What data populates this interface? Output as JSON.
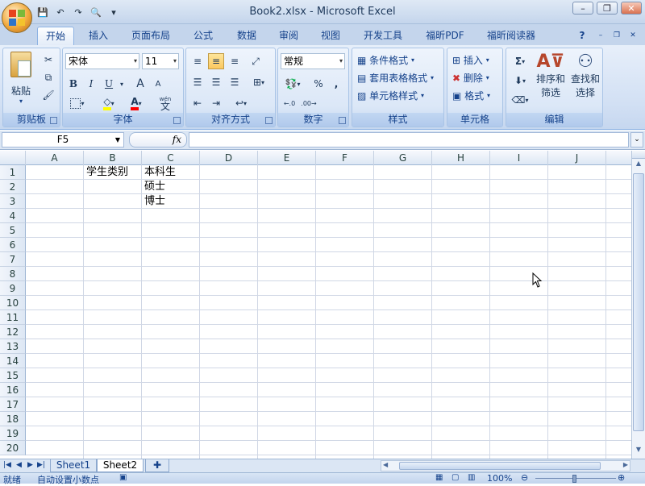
{
  "window": {
    "title": "Book2.xlsx - Microsoft Excel",
    "minimize": "–",
    "restore": "❐",
    "close": "✕"
  },
  "qat": {
    "save": "💾",
    "undo": "↶",
    "redo": "↷",
    "preview": "🔍",
    "more": "▾"
  },
  "tabs": [
    "开始",
    "插入",
    "页面布局",
    "公式",
    "数据",
    "审阅",
    "视图",
    "开发工具",
    "福昕PDF",
    "福昕阅读器"
  ],
  "active_tab": "开始",
  "ribbon": {
    "clipboard": {
      "label": "剪贴板",
      "paste": "粘贴"
    },
    "font": {
      "label": "字体",
      "name": "宋体",
      "size": "11",
      "bold": "B",
      "italic": "I",
      "underline": "U",
      "grow": "A",
      "shrink": "A",
      "wen": "wén",
      "wen_char": "文"
    },
    "alignment": {
      "label": "对齐方式"
    },
    "number": {
      "label": "数字",
      "format": "常规",
      "percent": "%",
      "comma": ","
    },
    "styles": {
      "label": "样式",
      "conditional": "条件格式",
      "table": "套用表格格式",
      "cell": "单元格样式"
    },
    "cells": {
      "label": "单元格",
      "insert": "插入",
      "delete": "删除",
      "format": "格式"
    },
    "editing": {
      "label": "编辑",
      "sort_line1": "排序和",
      "sort_line2": "筛选",
      "find_line1": "查找和",
      "find_line2": "选择",
      "sigma": "Σ"
    }
  },
  "formula_bar": {
    "name_box": "F5",
    "fx": "fx",
    "content": ""
  },
  "columns": [
    "A",
    "B",
    "C",
    "D",
    "E",
    "F",
    "G",
    "H",
    "I",
    "J"
  ],
  "rows": [
    "1",
    "2",
    "3",
    "4",
    "5",
    "6",
    "7",
    "8",
    "9",
    "10",
    "11",
    "12",
    "13",
    "14",
    "15",
    "16",
    "17",
    "18",
    "19",
    "20"
  ],
  "cells": {
    "B1": "学生类别",
    "C1": "本科生",
    "C2": "硕士",
    "C3": "博士"
  },
  "sheets": [
    "Sheet1",
    "Sheet2"
  ],
  "active_sheet": "Sheet2",
  "status": {
    "ready": "就绪",
    "macro": "自动设置小数点",
    "zoom": "100%"
  }
}
